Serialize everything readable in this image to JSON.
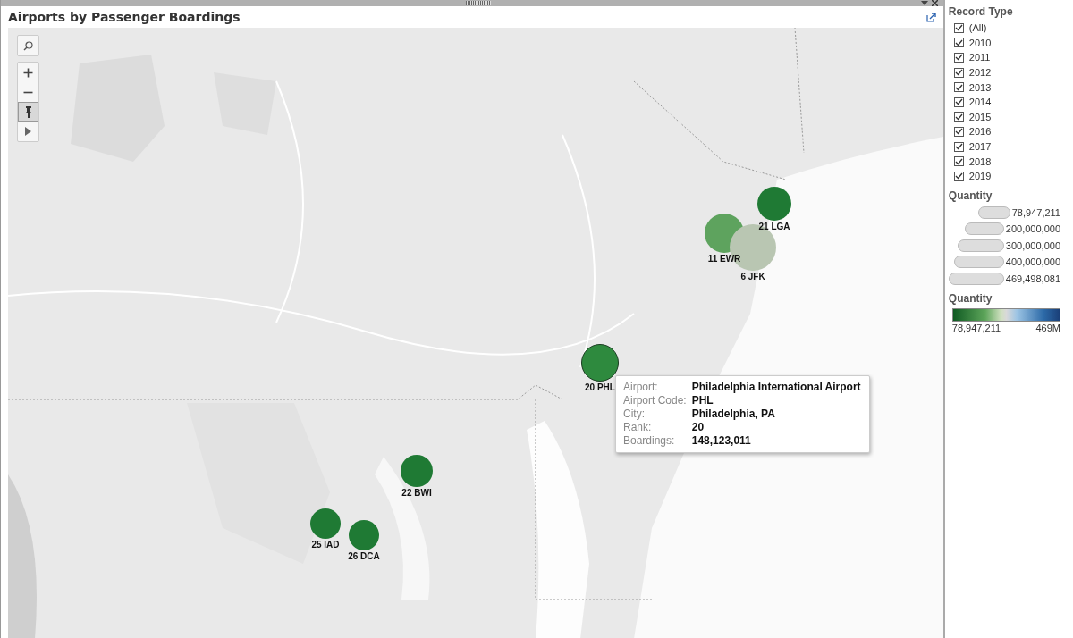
{
  "title": "Airports by Passenger Boardings",
  "map_controls": [
    {
      "kind": "search",
      "selected": false
    },
    {
      "kind": "zoom-in",
      "selected": false
    },
    {
      "kind": "zoom-out",
      "selected": false
    },
    {
      "kind": "pin",
      "selected": true
    },
    {
      "kind": "play",
      "selected": false
    }
  ],
  "airports": [
    {
      "label": "21 LGA",
      "color": "#1f7a34",
      "selected": false
    },
    {
      "label": "11 EWR",
      "color": "#5ea35e",
      "selected": false
    },
    {
      "label": "6 JFK",
      "color": "#b9c6b2",
      "selected": false
    },
    {
      "label": "20 PHL",
      "color": "#2e8a3e",
      "selected": true
    },
    {
      "label": "22 BWI",
      "color": "#1f7a34",
      "selected": false
    },
    {
      "label": "25 IAD",
      "color": "#1f7a34",
      "selected": false
    },
    {
      "label": "26 DCA",
      "color": "#1f7a34",
      "selected": false
    }
  ],
  "tooltip": [
    {
      "label": "Airport:",
      "value": "Philadelphia International Airport"
    },
    {
      "label": "Airport Code:",
      "value": "PHL"
    },
    {
      "label": "City:",
      "value": "Philadelphia, PA"
    },
    {
      "label": "Rank:",
      "value": "20"
    },
    {
      "label": "Boardings:",
      "value": "148,123,011"
    }
  ],
  "record_type": {
    "title": "Record Type",
    "items": [
      {
        "label": "(All)",
        "checked": true
      },
      {
        "label": "2010",
        "checked": true
      },
      {
        "label": "2011",
        "checked": true
      },
      {
        "label": "2012",
        "checked": true
      },
      {
        "label": "2013",
        "checked": true
      },
      {
        "label": "2014",
        "checked": true
      },
      {
        "label": "2015",
        "checked": true
      },
      {
        "label": "2016",
        "checked": true
      },
      {
        "label": "2017",
        "checked": true
      },
      {
        "label": "2018",
        "checked": true
      },
      {
        "label": "2019",
        "checked": true
      }
    ]
  },
  "size_legend": {
    "title": "Quantity",
    "items": [
      "78,947,211",
      "200,000,000",
      "300,000,000",
      "400,000,000",
      "469,498,081"
    ]
  },
  "color_legend": {
    "title": "Quantity",
    "min": "78,947,211",
    "max": "469M"
  }
}
